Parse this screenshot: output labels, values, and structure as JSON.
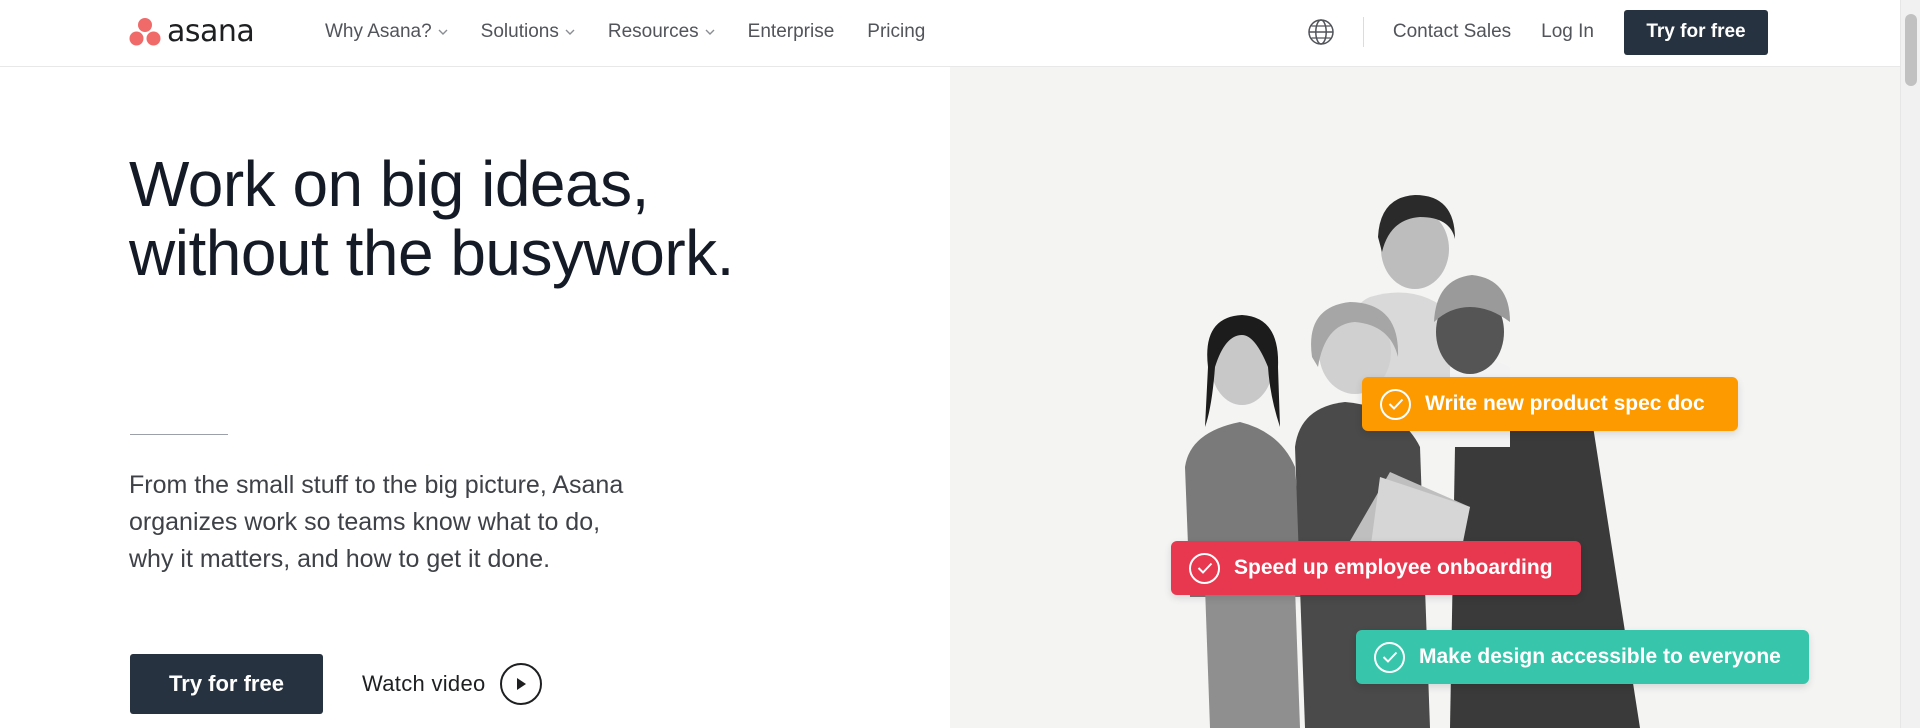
{
  "header": {
    "logo_text": "asana",
    "nav": [
      {
        "label": "Why Asana?",
        "has_dropdown": true
      },
      {
        "label": "Solutions",
        "has_dropdown": true
      },
      {
        "label": "Resources",
        "has_dropdown": true
      },
      {
        "label": "Enterprise",
        "has_dropdown": false
      },
      {
        "label": "Pricing",
        "has_dropdown": false
      }
    ],
    "globe_icon": "globe-icon",
    "contact_sales": "Contact Sales",
    "log_in": "Log In",
    "try_free": "Try for free"
  },
  "hero": {
    "headline_line1": "Work on big ideas,",
    "headline_line2": "without the busywork.",
    "description_line1": "From the small stuff to the big picture, Asana",
    "description_line2": "organizes work so teams know what to do,",
    "description_line3": "why it matters, and how to get it done.",
    "cta_label": "Try for free",
    "watch_label": "Watch video",
    "play_icon": "play-icon"
  },
  "tasks": [
    {
      "label": "Write new product spec doc",
      "color": "#fd9a00"
    },
    {
      "label": "Speed up employee onboarding",
      "color": "#e8384f"
    },
    {
      "label": "Make design accessible to everyone",
      "color": "#37c5ab"
    }
  ],
  "colors": {
    "dark_button": "#273240",
    "logo_coral": "#f06a6a",
    "hero_panel_bg": "#f4f4f3"
  }
}
